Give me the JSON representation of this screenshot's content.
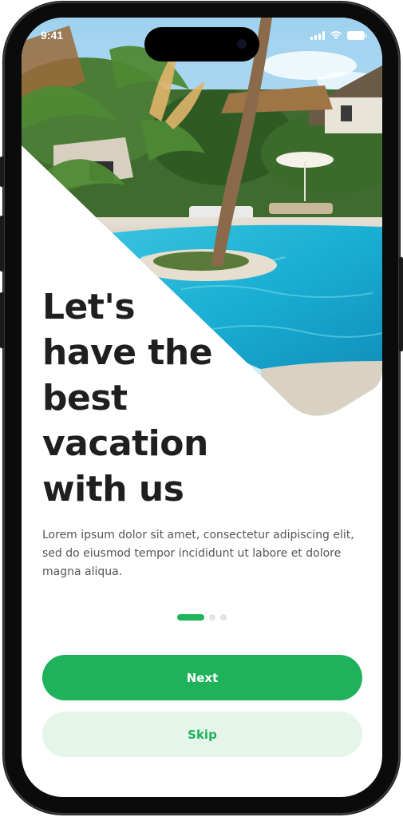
{
  "status_bar": {
    "time": "9:41",
    "icons": [
      "signal-icon",
      "wifi-icon",
      "battery-icon"
    ]
  },
  "hero": {
    "image": "resort-pool-palm-trees-photo"
  },
  "onboarding": {
    "headline_lines": [
      "Let's",
      "have the",
      "best",
      "vacation",
      "with us"
    ],
    "description": "Lorem ipsum dolor sit amet, consectetur adipiscing elit, sed do eiusmod tempor incididunt ut labore et dolore magna aliqua.",
    "pagination": {
      "current": 1,
      "total": 3
    }
  },
  "actions": {
    "next_label": "Next",
    "skip_label": "Skip"
  },
  "colors": {
    "accent": "#1fb25a",
    "accent_light": "#e6f5ea",
    "headline": "#1f1f1f",
    "body": "#555555"
  }
}
